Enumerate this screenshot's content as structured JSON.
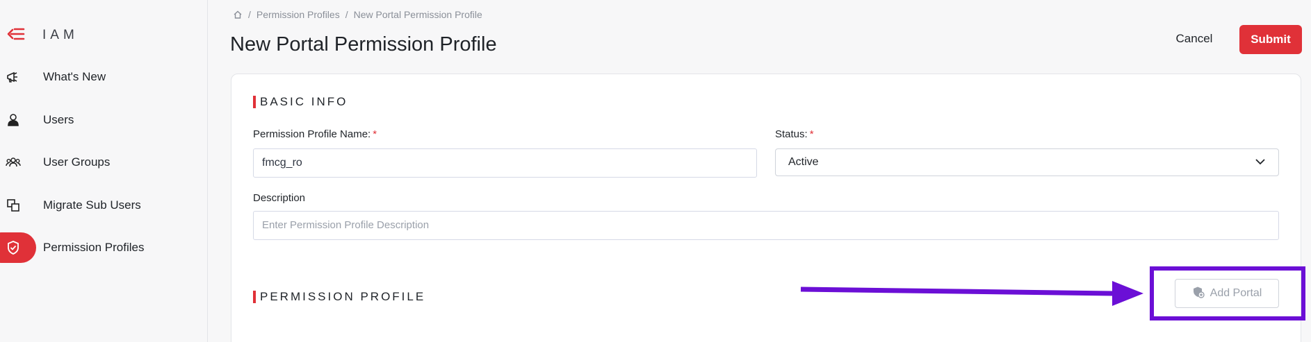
{
  "sidebar": {
    "brand": "IAM",
    "items": [
      {
        "label": "What's New",
        "icon": "megaphone-icon",
        "active": false
      },
      {
        "label": "Users",
        "icon": "user-icon",
        "active": false
      },
      {
        "label": "User Groups",
        "icon": "user-groups-icon",
        "active": false
      },
      {
        "label": "Migrate Sub Users",
        "icon": "migrate-icon",
        "active": false
      },
      {
        "label": "Permission Profiles",
        "icon": "shield-icon",
        "active": true
      }
    ]
  },
  "breadcrumb": {
    "items": [
      "Permission Profiles",
      "New Portal Permission Profile"
    ],
    "separator": "/"
  },
  "header": {
    "title": "New Portal Permission Profile",
    "cancel_label": "Cancel",
    "submit_label": "Submit"
  },
  "basic_info": {
    "section_title": "BASIC INFO",
    "name_label": "Permission Profile Name:",
    "name_value": "fmcg_ro",
    "status_label": "Status:",
    "status_value": "Active",
    "required_mark": "*",
    "description_label": "Description",
    "description_placeholder": "Enter Permission Profile Description"
  },
  "permission_profile": {
    "section_title": "PERMISSION PROFILE",
    "add_portal_label": "Add Portal"
  },
  "colors": {
    "accent": "#e03138",
    "annotation": "#6b0fd6"
  }
}
